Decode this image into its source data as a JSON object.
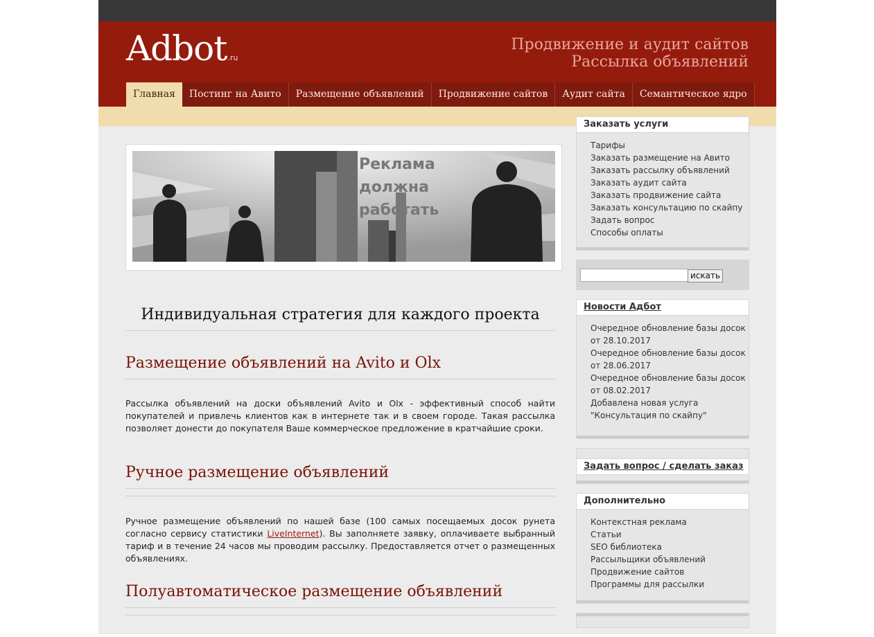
{
  "header": {
    "logo": "Adbot",
    "logo_suffix": ".ru",
    "tagline_1": "Продвижение и аудит сайтов",
    "tagline_2": "Рассылка объявлений"
  },
  "nav": {
    "items": [
      {
        "label": "Главная"
      },
      {
        "label": "Постинг на Авито"
      },
      {
        "label": "Размещение объявлений"
      },
      {
        "label": "Продвижение сайтов"
      },
      {
        "label": "Аудит сайта"
      },
      {
        "label": "Семантическое ядро"
      }
    ]
  },
  "banner": {
    "text_1": "Реклама",
    "text_2": "должна",
    "text_3": "работать"
  },
  "main": {
    "lead": "Индивидуальная стратегия для каждого проекта",
    "section1_title": "Размещение объявлений на Avito и Olx",
    "section1_text": "Рассылка объявлений на доски объявлений Avito и Olx - эффективный способ найти покупателей и привлечь клиентов как в интернете так и в своем городе. Такая рассылка позволяет донести до покупателя Ваше коммерческое предложение в кратчайшие сроки.",
    "section2_title": "Ручное размещение объявлений",
    "section2_text_before": "Ручное размещение объявлений по нашей базе (100 самых посещаемых досок рунета согласно сервису статистики ",
    "section2_link": "LiveInternet",
    "section2_text_after": "). Вы заполняете заявку, оплачиваете выбранный тариф и в течение 24 часов мы проводим рассылку. Предоставляется отчет о размещенных объявлениях.",
    "section3_title": "Полуавтоматическое размещение объявлений"
  },
  "sidebar": {
    "order": {
      "title": "Заказать услуги",
      "items": [
        "Тарифы",
        "Заказать размещение на Авито",
        "Заказать рассылку объявлений",
        "Заказать аудит сайта",
        "Заказать продвижение сайта",
        "Заказать консультацию по скайпу",
        "Задать вопрос",
        "Способы оплаты"
      ]
    },
    "search": {
      "value": "",
      "button": "искать"
    },
    "news": {
      "title": "Новости Адбот",
      "items": [
        "Очередное обновление базы досок",
        "от 28.10.2017",
        "Очередное обновление базы досок",
        "от 28.06.2017",
        "Очередное обновление базы досок",
        "от 08.02.2017",
        "Добавлена новая услуга",
        "\"Консультация по скайпу\""
      ]
    },
    "ask": {
      "title": "Задать вопрос / сделать заказ"
    },
    "extra": {
      "title": "Дополнительно",
      "items": [
        "Контекстная реклама",
        "Статьи",
        "SEO библиотека",
        "Рассыльщики объявлений",
        "Продвижение сайтов",
        "Программы для рассылки"
      ]
    }
  }
}
